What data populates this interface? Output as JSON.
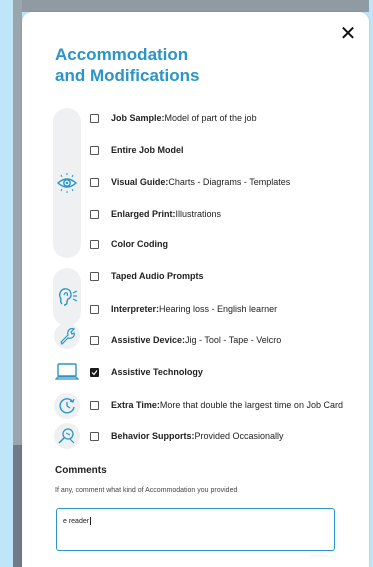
{
  "modal": {
    "title_line1": "Accommodation",
    "title_line2": "and Modifications",
    "close_label": "✕"
  },
  "items": [
    {
      "bold": "Job Sample:",
      "text": " Model of part of the job",
      "checked": false
    },
    {
      "bold": "Entire Job Model",
      "text": "",
      "checked": false
    },
    {
      "bold": "Visual Guide:",
      "text": " Charts - Diagrams - Templates",
      "checked": false
    },
    {
      "bold": "Enlarged Print:",
      "text": " Illustrations",
      "checked": false
    },
    {
      "bold": "Color Coding",
      "text": "",
      "checked": false
    },
    {
      "bold": "Taped Audio Prompts",
      "text": "",
      "checked": false
    },
    {
      "bold": "Interpreter:",
      "text": " Hearing loss - English learner",
      "checked": false
    },
    {
      "bold": "Assistive Device:",
      "text": " Jig - Tool - Tape - Velcro",
      "checked": false
    },
    {
      "bold": "Assistive Technology",
      "text": "",
      "checked": true
    },
    {
      "bold": "Extra Time:",
      "text": " More that double the largest time on Job Card",
      "checked": false
    },
    {
      "bold": "Behavior Supports:",
      "text": " Provided Occasionally",
      "checked": false
    }
  ],
  "comments": {
    "heading": "Comments",
    "subtext": "If any, comment what kind of Accommodation you provided",
    "value": "e reader"
  },
  "colors": {
    "accent": "#2a95c6",
    "icon": "#2a95c6"
  }
}
